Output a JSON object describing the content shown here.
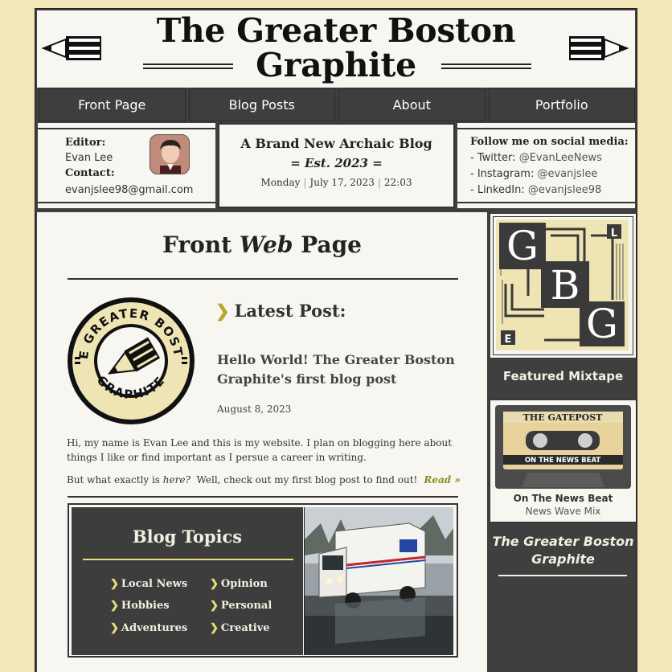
{
  "masthead": {
    "title_line1": "The Greater Boston",
    "title_line2": "Graphite"
  },
  "nav": {
    "items": [
      "Front Page",
      "Blog Posts",
      "About",
      "Portfolio"
    ]
  },
  "editor": {
    "editor_label": "Editor:",
    "editor_name": "Evan Lee",
    "contact_label": "Contact:",
    "email": "evanjslee98@gmail.com"
  },
  "blog_info": {
    "title": "A Brand New Archaic Blog",
    "established": "= Est. 2023 =",
    "day": "Monday",
    "date": "July 17, 2023",
    "time": "22:03"
  },
  "social": {
    "heading": "Follow me on social media:",
    "links": [
      {
        "label": "- Twitter: ",
        "handle": "@EvanLeeNews"
      },
      {
        "label": "- Instagram: ",
        "handle": "@evanjslee"
      },
      {
        "label": "- LinkedIn: ",
        "handle": "@evanjslee98"
      }
    ]
  },
  "main": {
    "page_title_a": "Front ",
    "page_title_b": "Web",
    "page_title_c": " Page",
    "latest_heading": "Latest Post:",
    "post_title": "Hello World! The Greater Boston Graphite's first blog post",
    "post_date": "August 8, 2023",
    "intro": "Hi, my name is Evan Lee and this is my website. I plan on blogging here about things I like or find important as I persue a career in writing.",
    "teaser_a": "But what exactly is ",
    "teaser_b": "here?",
    "teaser_c": "  Well, check out my first blog post to find out!",
    "read_more": "Read »",
    "badge_text_top": "THE GREATER BOSTON",
    "badge_text_bottom": "GRAPHITE"
  },
  "topics": {
    "title": "Blog Topics",
    "items": [
      "Local News",
      "Opinion",
      "Hobbies",
      "Personal",
      "Adventures",
      "Creative"
    ]
  },
  "sidebar": {
    "logo_letters": [
      "G",
      "B",
      "G",
      "L",
      "E"
    ],
    "mixtape_heading": "Featured Mixtape",
    "cassette_label": "THE GATEPOST",
    "cassette_band": "ON THE NEWS BEAT",
    "mixtape_name": "On The News Beat",
    "mixtape_sub": "News Wave Mix",
    "brand_line1": "The Greater Boston",
    "brand_line2": "Graphite"
  },
  "colors": {
    "page_bg": "#f3e6b8",
    "frame": "#3f3f3f",
    "paper": "#f7f6f1",
    "accent": "#e9df7a",
    "link": "#8b8a20"
  }
}
